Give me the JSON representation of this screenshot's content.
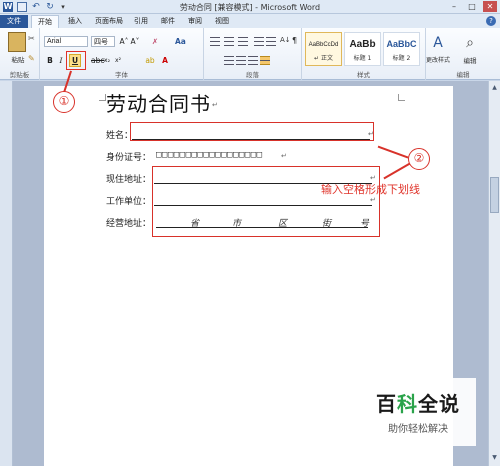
{
  "window": {
    "title": "劳动合同 [兼容模式] - Microsoft Word",
    "file_tab": "文件",
    "tabs": [
      "开始",
      "插入",
      "页面布局",
      "引用",
      "邮件",
      "审阅",
      "视图"
    ],
    "min_glyph": "–",
    "max_glyph": "□",
    "close_glyph": "✕",
    "help_glyph": "?"
  },
  "ribbon": {
    "clipboard": {
      "label": "剪贴板",
      "paste": "粘贴"
    },
    "font": {
      "label": "字体",
      "font_name": "Arial",
      "font_size": "四号",
      "bold": "B",
      "italic": "I",
      "underline": "U",
      "strike": "abc",
      "subscript": "x₂",
      "superscript": "x²",
      "grow": "A˄",
      "shrink": "A˅",
      "color": "A",
      "highlight": "ab",
      "abc": "Aa"
    },
    "paragraph": {
      "label": "段落"
    },
    "styles": {
      "label": "样式",
      "items": [
        {
          "sample": "AaBbCcDd",
          "name": "↵ 正文"
        },
        {
          "sample": "AaBb",
          "name": "标题 1"
        },
        {
          "sample": "AaBbC",
          "name": "标题 2"
        }
      ],
      "change_styles": "更改样式"
    },
    "editing": {
      "label": "编辑"
    }
  },
  "document": {
    "title": "劳动合同书",
    "fields": [
      {
        "label": "姓名："
      },
      {
        "label": "身份证号：",
        "boxes": "□□□□□□□□□□□□□□□□□□"
      },
      {
        "label": "现住地址："
      },
      {
        "label": "工作单位："
      },
      {
        "label": "经营地址："
      }
    ],
    "address_parts": [
      "省",
      "市",
      "区",
      "街",
      "号"
    ],
    "para_mark": "↵"
  },
  "annotations": {
    "marker_1": "①",
    "marker_2": "②",
    "note": "输入空格形成下划线"
  },
  "watermark": {
    "title_a": "百",
    "title_b": "科",
    "title_c": "全说",
    "subtitle": "助你轻松解决"
  }
}
